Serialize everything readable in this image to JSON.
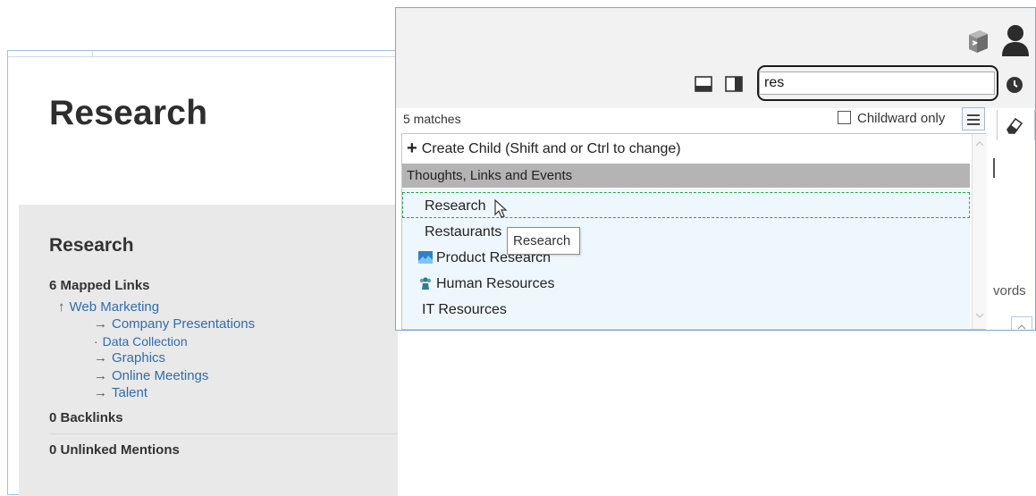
{
  "page": {
    "title": "Research"
  },
  "links_panel": {
    "title": "Research",
    "mapped_links_heading": "6 Mapped Links",
    "mapped_links": [
      {
        "glyph": "↑",
        "label": "Web Marketing"
      },
      {
        "glyph": "→",
        "label": "Company Presentations"
      },
      {
        "glyph": "·",
        "label": "Data Collection"
      },
      {
        "glyph": "→",
        "label": "Graphics"
      },
      {
        "glyph": "→",
        "label": "Online Meetings"
      },
      {
        "glyph": "→",
        "label": "Talent"
      }
    ],
    "backlinks_heading": "0 Backlinks",
    "unlinked_heading": "0 Unlinked Mentions"
  },
  "search": {
    "value": "res",
    "matches_text": "5 matches",
    "childward_label": "Childward only",
    "childward_checked": false,
    "create_child_label": "Create Child (Shift and or Ctrl to change)",
    "group_label": "Thoughts, Links and Events",
    "results": [
      {
        "label": "Research",
        "icon": null,
        "selected": true
      },
      {
        "label": "Restaurants",
        "icon": null,
        "selected": false
      },
      {
        "label": "Product Research",
        "icon": "image-icon",
        "selected": false
      },
      {
        "label": "Human Resources",
        "icon": "people-icon",
        "selected": false
      },
      {
        "label": "IT Resources",
        "icon": null,
        "selected": false
      }
    ],
    "tooltip": "Research"
  },
  "side": {
    "tab_label": "vords"
  },
  "icons": {
    "toolbar": [
      "cube-icon",
      "user-icon",
      "layout-bottom-icon",
      "layout-right-icon",
      "history-icon",
      "eraser-icon",
      "menu-icon"
    ]
  },
  "colors": {
    "link": "#2f6db0",
    "selection_border": "#24a24a",
    "results_bg": "#eef7fd",
    "group_bg": "#b4b4b4"
  }
}
